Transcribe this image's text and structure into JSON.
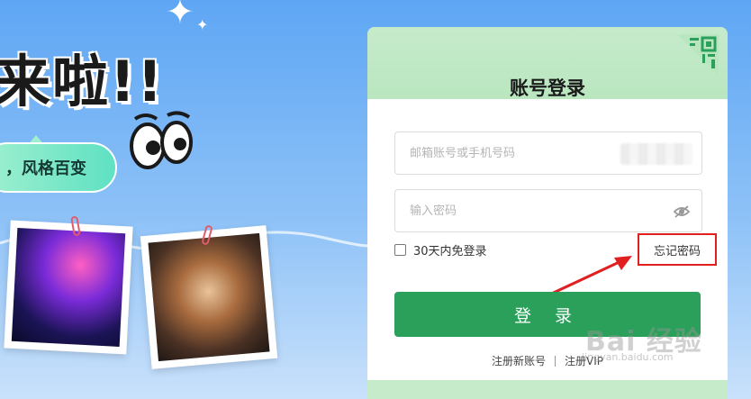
{
  "hero": {
    "headline": "来啦!!",
    "pill_text": "，风格百变"
  },
  "login": {
    "title": "账号登录",
    "account_placeholder": "邮箱账号或手机号码",
    "password_placeholder": "输入密码",
    "remember_label": "30天内免登录",
    "forgot_label": "忘记密码",
    "login_button": "登 录",
    "register_link": "注册新账号",
    "vip_link": "注册VIP"
  },
  "watermark": {
    "text": "Bai 经验",
    "sub": "jingyan.baidu.com"
  },
  "colors": {
    "primary_green": "#2aa05a",
    "header_green": "#c6ebcb",
    "highlight_red": "#e02020"
  },
  "icons": {
    "qr": "qr-code-icon",
    "eye": "eye-off-icon",
    "sparkle": "sparkle-icon"
  }
}
